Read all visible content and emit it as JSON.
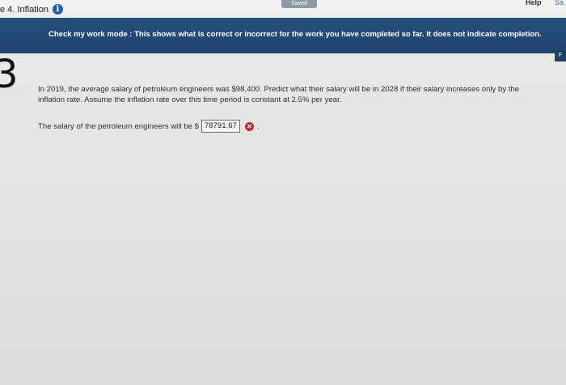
{
  "header": {
    "title": "e 4. Inflation",
    "saved_label": "Saved",
    "help_label": "Help",
    "save_tab_label": "Sa"
  },
  "banner": {
    "mode_text": "Check my work mode : This shows what is correct or incorrect for the work you have completed so far. It does not indicate completion."
  },
  "question": {
    "number": "3",
    "side_tab": "F",
    "text": "In 2019, the average salary of petroleum engineers was $98,400. Predict what their salary will be in 2028 if their salary increases only by the inflation rate. Assume the inflation rate over this time period is constant at 2.5% per year.",
    "answer_prefix": "The salary of the petroleum engineers will be $",
    "answer_value": "78791.67",
    "answer_suffix": ".",
    "answer_status": "incorrect"
  },
  "colors": {
    "banner": "#234a75",
    "incorrect": "#c8232c",
    "info": "#1e63a8"
  }
}
